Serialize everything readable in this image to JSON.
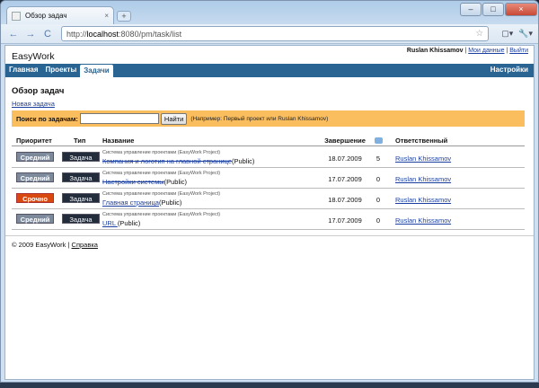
{
  "browser": {
    "tab_title": "Обзор задач",
    "tab_close": "×",
    "new_tab": "+",
    "url_scheme": "http://",
    "url_host": "localhost",
    "url_rest": ":8080/pm/task/list",
    "controls": {
      "minimize": "–",
      "maximize": "□",
      "close": "×"
    },
    "back": "←",
    "forward": "→",
    "reload": "C",
    "star": "☆",
    "page_menu": "▢▾",
    "tools_menu": "🔧▾"
  },
  "app": {
    "logo": "EasyWork",
    "user": {
      "name": "Ruslan Khissamov",
      "sep1": " | ",
      "my_data": "Мои данные",
      "sep2": " | ",
      "logout": "Выйти"
    },
    "menu": {
      "home": "Главная",
      "projects": "Проекты",
      "tasks": "Задачи",
      "settings": "Настройки"
    },
    "page_title": "Обзор задач",
    "new_task": "Новая задача",
    "search": {
      "label": "Поиск по задачам:",
      "value": "",
      "button": "Найти",
      "hint": "(Например: Первый проект или Ruslan Khissamov)"
    },
    "columns": {
      "priority": "Приоритет",
      "type": "Тип",
      "name": "Название",
      "due": "Завершение",
      "comments_icon": "comment-icon",
      "responsible": "Ответственный"
    },
    "tasks": [
      {
        "priority": "Средний",
        "urgent": false,
        "type": "Задача",
        "project": "Система управление проектами (EasyWork Project)",
        "name": "Компания и логотип на главной странице",
        "strike": true,
        "visibility": "(Public)",
        "due": "18.07.2009",
        "comments": "5",
        "responsible": "Ruslan Khissamov"
      },
      {
        "priority": "Средний",
        "urgent": false,
        "type": "Задача",
        "project": "Система управление проектами (EasyWork Project)",
        "name": "Настройки системы",
        "strike": true,
        "visibility": "(Public)",
        "due": "17.07.2009",
        "comments": "0",
        "responsible": "Ruslan Khissamov"
      },
      {
        "priority": "Срочно",
        "urgent": true,
        "type": "Задача",
        "project": "Система управление проектами (EasyWork Project)",
        "name": "Главная страница",
        "strike": false,
        "visibility": "(Public)",
        "due": "18.07.2009",
        "comments": "0",
        "responsible": "Ruslan Khissamov"
      },
      {
        "priority": "Средний",
        "urgent": false,
        "type": "Задача",
        "project": "Система управление проектами (EasyWork Project)",
        "name": "URL ",
        "strike": false,
        "visibility": "(Public)",
        "due": "17.07.2009",
        "comments": "0",
        "responsible": "Ruslan Khissamov"
      }
    ],
    "footer": {
      "copyright": "© 2009 EasyWork | ",
      "help": "Справка"
    },
    "colors": {
      "menu": "#2a6493",
      "search_bar": "#fbbe5f",
      "urgent": "#d9480f",
      "badge": "#7d8a9c",
      "type_badge": "#222c3b",
      "link": "#1a3fa0"
    }
  }
}
